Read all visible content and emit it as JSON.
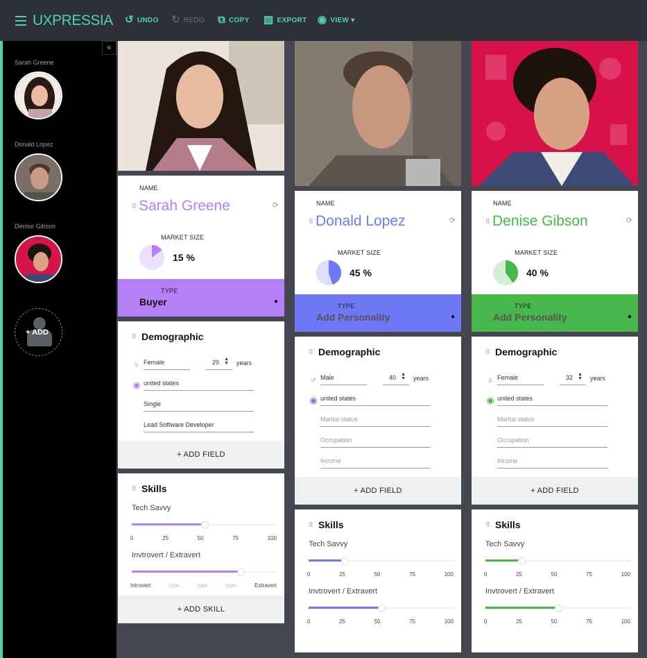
{
  "app": {
    "brand": "UXPRESSIA",
    "accent": "#4fd1ad",
    "toolbar": [
      {
        "id": "undo",
        "label": "UNDO",
        "icon": "↺",
        "enabled": true
      },
      {
        "id": "redo",
        "label": "REDO",
        "icon": "↻",
        "enabled": false
      },
      {
        "id": "copy",
        "label": "COPY",
        "icon": "⧉",
        "enabled": true
      },
      {
        "id": "export",
        "label": "EXPORT",
        "icon": "▨",
        "enabled": true
      },
      {
        "id": "view",
        "label": "VIEW ▾",
        "icon": "◉",
        "enabled": true
      }
    ]
  },
  "sidebar": {
    "collapse_icon": "«",
    "personas": [
      {
        "name": "Sarah Greene"
      },
      {
        "name": "Donald Lopez"
      },
      {
        "name": "Denise Gibson"
      }
    ],
    "add_label": "+ ADD"
  },
  "labels": {
    "name": "NAME",
    "market_size": "MARKET SIZE",
    "type": "TYPE",
    "demographic": "Demographic",
    "years": "years",
    "add_field": "+ ADD FIELD",
    "skills": "Skills",
    "add_skill": "+ ADD SKILL",
    "drag": "⠿",
    "refresh": "⟳",
    "bulb": "💡"
  },
  "personas": [
    {
      "name": "Sarah Greene",
      "color": "#b580f7",
      "light": "#ece0fd",
      "market_size": 15,
      "market_size_label": "15 %",
      "type": "Buyer",
      "type_placeholder": false,
      "gender": "Female",
      "gender_icon": "♀",
      "age": "29",
      "location": "united states",
      "marital": {
        "value": "Single",
        "placeholder": false
      },
      "occupation": {
        "value": "Lead Software Developer",
        "placeholder": false
      },
      "income": null,
      "skills": [
        {
          "label": "Tech Savvy",
          "value": 50,
          "ticks": [
            "0",
            "25",
            "50",
            "75",
            "100"
          ],
          "placeholder_ticks": []
        },
        {
          "label": "Invtrovert / Extravert",
          "value": 75,
          "ticks": [
            "Introvert",
            "type",
            "type",
            "type",
            "Extravert"
          ],
          "placeholder_ticks": [
            1,
            2,
            3
          ]
        }
      ],
      "show_add_skill": true
    },
    {
      "name": "Donald Lopez",
      "color": "#6f78f4",
      "light": "#dcdffc",
      "market_size": 45,
      "market_size_label": "45 %",
      "type": "Add Personality",
      "type_placeholder": true,
      "gender": "Male",
      "gender_icon": "♂",
      "age": "40",
      "location": "united states",
      "marital": {
        "value": "Marital status",
        "placeholder": true
      },
      "occupation": {
        "value": "Occupation",
        "placeholder": true
      },
      "income": {
        "value": "Income",
        "placeholder": true
      },
      "skills": [
        {
          "label": "Tech Savvy",
          "value": 25,
          "ticks": [
            "0",
            "25",
            "50",
            "75",
            "100"
          ],
          "placeholder_ticks": []
        },
        {
          "label": "Invtrovert / Extravert",
          "value": 50,
          "ticks": [
            "0",
            "25",
            "50",
            "75",
            "100"
          ],
          "placeholder_ticks": []
        }
      ],
      "show_add_skill": false
    },
    {
      "name": "Denise Gibson",
      "color": "#47b74b",
      "light": "#d6eed6",
      "market_size": 40,
      "market_size_label": "40 %",
      "type": "Add Personality",
      "type_placeholder": true,
      "gender": "Female",
      "gender_icon": "♀",
      "age": "32",
      "location": "united states",
      "marital": {
        "value": "Marital status",
        "placeholder": true
      },
      "occupation": {
        "value": "Occupation",
        "placeholder": true
      },
      "income": {
        "value": "Income",
        "placeholder": true
      },
      "skills": [
        {
          "label": "Tech Savvy",
          "value": 25,
          "ticks": [
            "0",
            "25",
            "50",
            "75",
            "100"
          ],
          "placeholder_ticks": []
        },
        {
          "label": "Invtrovert / Extravert",
          "value": 50,
          "ticks": [
            "0",
            "25",
            "50",
            "75",
            "100"
          ],
          "placeholder_ticks": []
        }
      ],
      "show_add_skill": false
    }
  ]
}
